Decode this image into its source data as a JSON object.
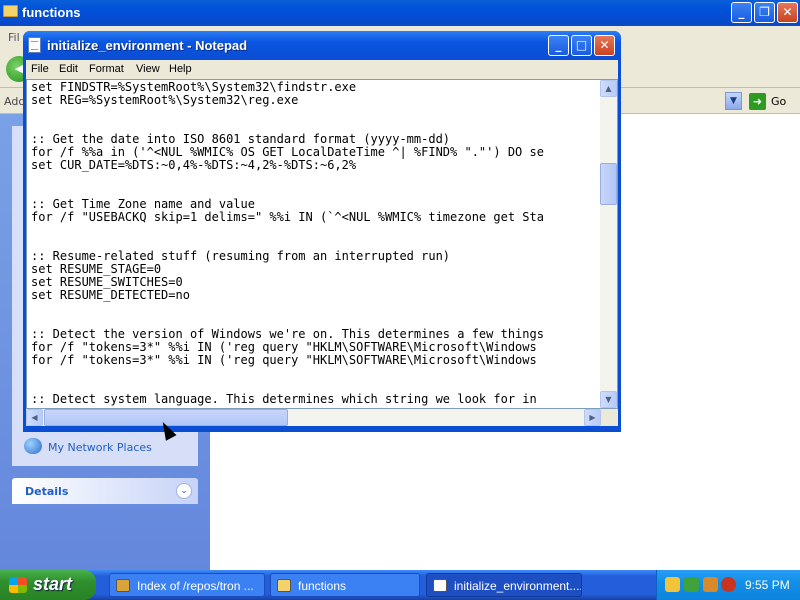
{
  "explorer": {
    "title": "functions",
    "menu_first": "Fil",
    "address_label": "Add",
    "go_label": "Go",
    "task_pane": {
      "network_link": "My Network Places",
      "details_label": "Details"
    }
  },
  "notepad": {
    "title": "initialize_environment - Notepad",
    "menu": [
      "File",
      "Edit",
      "Format",
      "View",
      "Help"
    ],
    "lines": [
      "set FINDSTR=%SystemRoot%\\System32\\findstr.exe",
      "set REG=%SystemRoot%\\System32\\reg.exe",
      "",
      "",
      ":: Get the date into ISO 8601 standard format (yyyy-mm-dd)",
      "for /f %%a in ('^<NUL %WMIC% OS GET LocalDateTime ^| %FIND% \".\"') DO se",
      "set CUR_DATE=%DTS:~0,4%-%DTS:~4,2%-%DTS:~6,2%",
      "",
      "",
      ":: Get Time Zone name and value",
      "for /f \"USEBACKQ skip=1 delims=\" %%i IN (`^<NUL %WMIC% timezone get Sta",
      "",
      "",
      ":: Resume-related stuff (resuming from an interrupted run)",
      "set RESUME_STAGE=0",
      "set RESUME_SWITCHES=0",
      "set RESUME_DETECTED=no",
      "",
      "",
      ":: Detect the version of Windows we're on. This determines a few things",
      "for /f \"tokens=3*\" %%i IN ('reg query \"HKLM\\SOFTWARE\\Microsoft\\Windows",
      "for /f \"tokens=3*\" %%i IN ('reg query \"HKLM\\SOFTWARE\\Microsoft\\Windows",
      "",
      "",
      ":: Detect system language. This determines which string we look for in"
    ]
  },
  "taskbar": {
    "start_label": "start",
    "tasks": [
      {
        "label": "Index of /repos/tron ...",
        "icon_color": "#d9a33a"
      },
      {
        "label": "functions",
        "icon_color": "#f4d46a"
      },
      {
        "label": "initialize_environment....",
        "icon_color": "#ffffff"
      }
    ],
    "clock": "9:55 PM"
  },
  "colors": {
    "title_blue": "#0a54e0",
    "taskbar_blue": "#245edb",
    "start_green": "#2f8f2e",
    "close_red": "#c8431f"
  }
}
